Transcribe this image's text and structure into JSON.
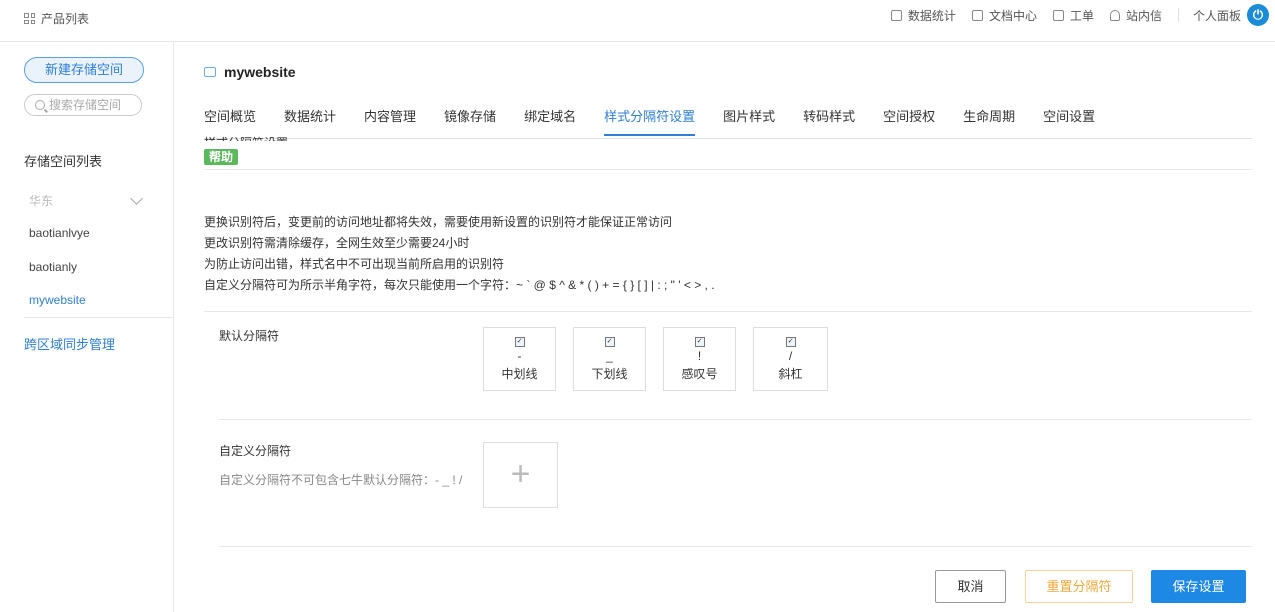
{
  "topbar": {
    "product_list": "产品列表",
    "nav": [
      {
        "label": "数据统计",
        "icon": "chart-icon"
      },
      {
        "label": "文档中心",
        "icon": "document-icon"
      },
      {
        "label": "工单",
        "icon": "clipboard-icon"
      },
      {
        "label": "站内信",
        "icon": "bell-icon"
      }
    ],
    "personal": "个人面板"
  },
  "sidebar": {
    "new_bucket": "新建存储空间",
    "search_placeholder": "搜索存储空间",
    "list_title": "存储空间列表",
    "region": "华东",
    "buckets": [
      "baotianlvye",
      "baotianly",
      "mywebsite"
    ],
    "cross_region": "跨区域同步管理"
  },
  "header": {
    "bucket_name": "mywebsite"
  },
  "tabs": [
    "空间概览",
    "数据统计",
    "内容管理",
    "镜像存储",
    "绑定域名",
    "样式分隔符设置",
    "图片样式",
    "转码样式",
    "空间授权",
    "生命周期",
    "空间设置"
  ],
  "active_tab": "样式分隔符设置",
  "section": {
    "title": "样式分隔符设置",
    "help": "帮助"
  },
  "notes": [
    "更换识别符后，变更前的访问地址都将失效，需要使用新设置的识别符才能保证正常访问",
    "更改识别符需清除缓存，全网生效至少需要24小时",
    "为防止访问出错，样式名中不可出现当前所启用的识别符",
    "自定义分隔符可为所示半角字符，每次只能使用一个字符：~ ` @ $ ^ & * ( ) + = { } [ ] | : ; \" ' < > , ."
  ],
  "default_sep": {
    "label": "默认分隔符",
    "items": [
      {
        "symbol": "-",
        "name": "中划线",
        "checked": true
      },
      {
        "symbol": "_",
        "name": "下划线",
        "checked": true
      },
      {
        "symbol": "!",
        "name": "感叹号",
        "checked": true
      },
      {
        "symbol": "/",
        "name": "斜杠",
        "checked": true
      }
    ]
  },
  "custom_sep": {
    "label": "自定义分隔符",
    "note": "自定义分隔符不可包含七牛默认分隔符：- _ ! /"
  },
  "buttons": {
    "cancel": "取消",
    "reset": "重置分隔符",
    "save": "保存设置"
  }
}
